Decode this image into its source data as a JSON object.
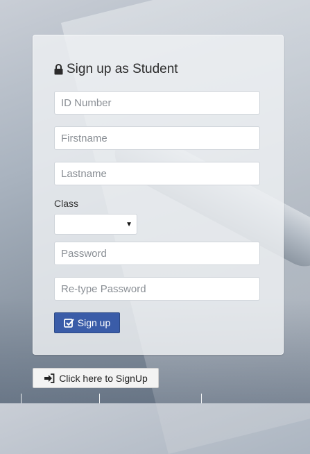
{
  "form": {
    "title": "Sign up as Student",
    "id_placeholder": "ID Number",
    "firstname_placeholder": "Firstname",
    "lastname_placeholder": "Lastname",
    "class_label": "Class",
    "class_value": "",
    "password_placeholder": "Password",
    "retype_placeholder": "Re-type Password",
    "submit_label": "Sign up"
  },
  "footer": {
    "signup_link_label": "Click here to SignUp"
  },
  "colors": {
    "primary_button": "#3a5ca8",
    "panel_background": "#eef0f3"
  },
  "icons": [
    "lock-icon",
    "check-square-icon",
    "sign-in-icon",
    "chevron-down-icon"
  ]
}
